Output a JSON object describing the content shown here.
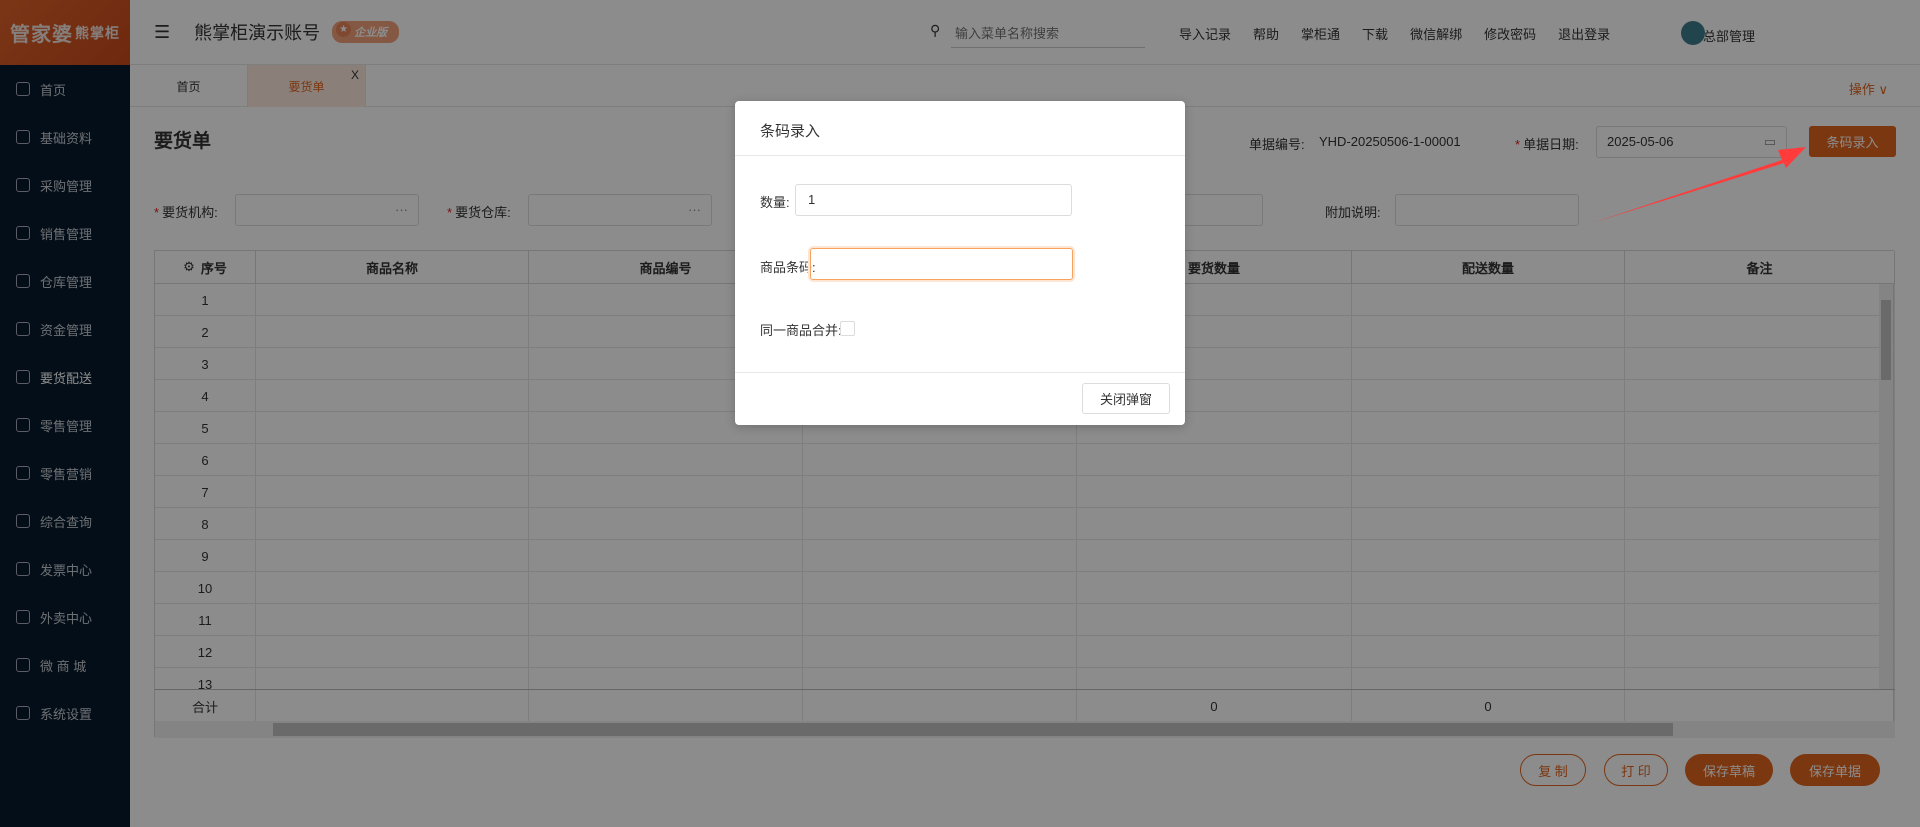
{
  "sidebar": {
    "logo": "管家婆",
    "logo_sub": "熊掌柜",
    "items": [
      {
        "label": "首页",
        "icon": "globe-icon"
      },
      {
        "label": "基础资料",
        "icon": "home-icon"
      },
      {
        "label": "采购管理",
        "icon": "cart-icon"
      },
      {
        "label": "销售管理",
        "icon": "sales-icon"
      },
      {
        "label": "仓库管理",
        "icon": "warehouse-icon"
      },
      {
        "label": "资金管理",
        "icon": "fund-icon"
      },
      {
        "label": "要货配送",
        "icon": "delivery-icon"
      },
      {
        "label": "零售管理",
        "icon": "chart-icon"
      },
      {
        "label": "零售营销",
        "icon": "gift-icon"
      },
      {
        "label": "综合查询",
        "icon": "query-icon"
      },
      {
        "label": "发票中心",
        "icon": "invoice-icon"
      },
      {
        "label": "外卖中心",
        "icon": "takeout-icon"
      },
      {
        "label": "微 商 城",
        "icon": "shop-icon"
      },
      {
        "label": "系统设置",
        "icon": "gear-icon"
      }
    ]
  },
  "header": {
    "account": "熊掌柜演示账号",
    "edition": "企业版",
    "search_placeholder": "输入菜单名称搜索",
    "links": [
      "导入记录",
      "帮助",
      "掌柜通",
      "下载",
      "微信解绑",
      "修改密码",
      "退出登录"
    ],
    "user": "总部管理"
  },
  "tabs": [
    {
      "label": "首页"
    },
    {
      "label": "要货单",
      "close": "X"
    }
  ],
  "ops": "操作 ∨",
  "page": {
    "title": "要货单",
    "doc_no_label": "单据编号:",
    "doc_no": "YHD-20250506-1-00001",
    "date_label": "单据日期:",
    "date": "2025-05-06",
    "barcode_btn": "条码录入",
    "org_label": "要货机构:",
    "wh_label": "要货仓库:",
    "note_label": "附加说明:",
    "ellipsis": "···"
  },
  "table": {
    "columns": [
      "序号",
      "商品名称",
      "商品编号",
      "",
      "要货数量",
      "配送数量",
      "备注"
    ],
    "rows": [
      "1",
      "2",
      "3",
      "4",
      "5",
      "6",
      "7",
      "8",
      "9",
      "10",
      "11",
      "12",
      "13"
    ],
    "total_label": "合计",
    "total_request": "0",
    "total_delivery": "0"
  },
  "actions": {
    "copy": "复 制",
    "print": "打 印",
    "save_draft": "保存草稿",
    "save": "保存单据"
  },
  "modal": {
    "title": "条码录入",
    "qty_label": "数量:",
    "qty": "1",
    "barcode_label": "商品条码:",
    "barcode": "",
    "merge_label": "同一商品合并:",
    "close": "关闭弹窗"
  },
  "colors": {
    "brand": "#e0651e",
    "sidebar": "#071a2c",
    "arrow": "#ff3b3b"
  }
}
